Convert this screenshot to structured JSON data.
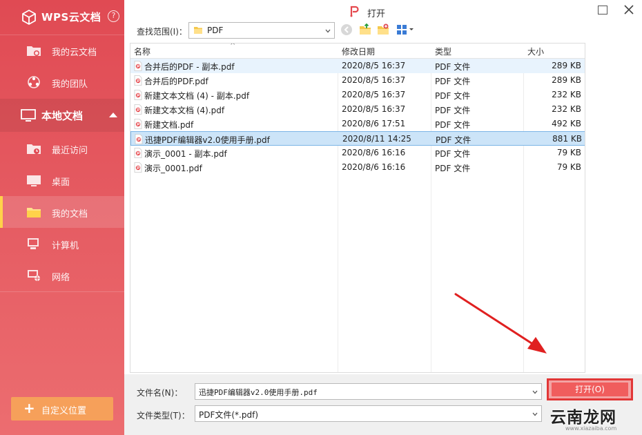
{
  "sidebar": {
    "brand_title": "WPS云文档",
    "help_glyph": "?",
    "cloud_items": [
      {
        "label": "我的云文档",
        "icon": "cloud-folder-icon"
      },
      {
        "label": "我的团队",
        "icon": "team-icon"
      }
    ],
    "local_section": {
      "label": "本地文档",
      "icon": "monitor-icon"
    },
    "local_items": [
      {
        "label": "最近访问",
        "icon": "recent-folder-icon",
        "active": false
      },
      {
        "label": "桌面",
        "icon": "desktop-icon",
        "active": false
      },
      {
        "label": "我的文档",
        "icon": "folder-icon",
        "active": true
      },
      {
        "label": "计算机",
        "icon": "computer-icon",
        "active": false
      },
      {
        "label": "网络",
        "icon": "network-icon",
        "active": false
      }
    ],
    "custom_location_label": "自定义位置",
    "custom_location_glyph": "+"
  },
  "dialog": {
    "title": "打开",
    "look_in_label": "查找范围(I)：",
    "look_in_value": "PDF"
  },
  "file_list": {
    "columns": {
      "name": "名称",
      "date": "修改日期",
      "type": "类型",
      "size": "大小"
    },
    "sort_glyph": "^",
    "rows": [
      {
        "name": "合并后的PDF - 副本.pdf",
        "date": "2020/8/5 16:37",
        "type": "PDF 文件",
        "size": "289 KB",
        "state": "hover"
      },
      {
        "name": "合并后的PDF.pdf",
        "date": "2020/8/5 16:37",
        "type": "PDF 文件",
        "size": "289 KB",
        "state": ""
      },
      {
        "name": "新建文本文档 (4) - 副本.pdf",
        "date": "2020/8/5 16:37",
        "type": "PDF 文件",
        "size": "232 KB",
        "state": ""
      },
      {
        "name": "新建文本文档 (4).pdf",
        "date": "2020/8/5 16:37",
        "type": "PDF 文件",
        "size": "232 KB",
        "state": ""
      },
      {
        "name": "新建文档.pdf",
        "date": "2020/8/6 17:51",
        "type": "PDF 文件",
        "size": "492 KB",
        "state": ""
      },
      {
        "name": "迅捷PDF编辑器v2.0使用手册.pdf",
        "date": "2020/8/11 14:25",
        "type": "PDF 文件",
        "size": "881 KB",
        "state": "selected"
      },
      {
        "name": "演示_0001 - 副本.pdf",
        "date": "2020/8/6 16:16",
        "type": "PDF 文件",
        "size": "79 KB",
        "state": ""
      },
      {
        "name": "演示_0001.pdf",
        "date": "2020/8/6 16:16",
        "type": "PDF 文件",
        "size": "79 KB",
        "state": ""
      }
    ]
  },
  "bottom": {
    "file_name_label": "文件名(N)：",
    "file_name_value": "迅捷PDF编辑器v2.0使用手册.pdf",
    "file_type_label": "文件类型(T)：",
    "file_type_value": "PDF文件(*.pdf)",
    "open_button_label": "打开(O)"
  },
  "watermark": {
    "main": "云南龙网",
    "sub": "www.xiazaiba.com"
  },
  "colors": {
    "sidebar": "#e04a53",
    "accent": "#ffd24a",
    "custom_button": "#f6a05a",
    "open_button": "#f05d5d",
    "annotation_red": "#e02020",
    "selection": "#cce4f8"
  }
}
